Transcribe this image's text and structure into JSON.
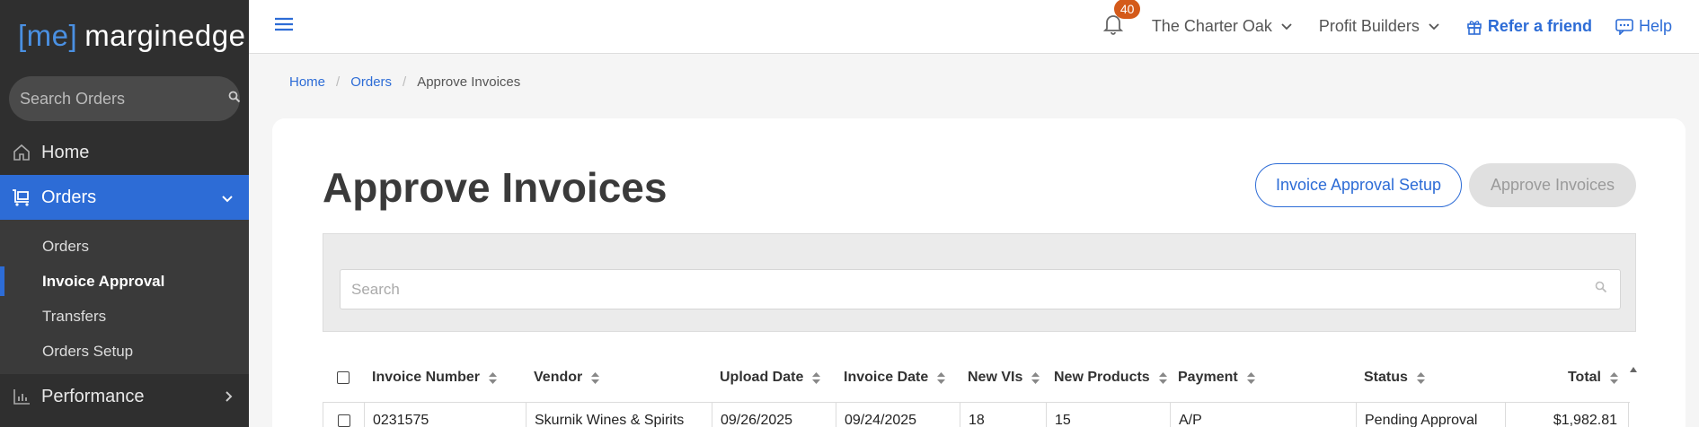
{
  "logo": {
    "open": "[",
    "me": "me",
    "close": "]",
    "name": "marginedge"
  },
  "sidebar": {
    "search_placeholder": "Search Orders",
    "home": "Home",
    "orders": "Orders",
    "sub_items": [
      "Orders",
      "Invoice Approval",
      "Transfers",
      "Orders Setup"
    ],
    "performance": "Performance"
  },
  "topbar": {
    "notification_count": "40",
    "restaurant": "The Charter Oak",
    "group": "Profit Builders",
    "refer": "Refer a friend",
    "help": "Help"
  },
  "breadcrumb": {
    "home": "Home",
    "orders": "Orders",
    "current": "Approve Invoices"
  },
  "page": {
    "title": "Approve Invoices",
    "setup_button": "Invoice Approval Setup",
    "approve_button": "Approve Invoices",
    "search_placeholder": "Search"
  },
  "table": {
    "headers": [
      "Invoice Number",
      "Vendor",
      "Upload Date",
      "Invoice Date",
      "New VIs",
      "New Products",
      "Payment",
      "Status",
      "Total"
    ],
    "rows": [
      [
        "0231575",
        "Skurnik Wines & Spirits",
        "09/26/2025",
        "09/24/2025",
        "18",
        "15",
        "A/P",
        "Pending Approval",
        "$1,982.81"
      ]
    ]
  },
  "colors": {
    "accent": "#2d6cd6",
    "sidebar_bg": "#2f2f2f",
    "badge": "#d45a1a"
  }
}
